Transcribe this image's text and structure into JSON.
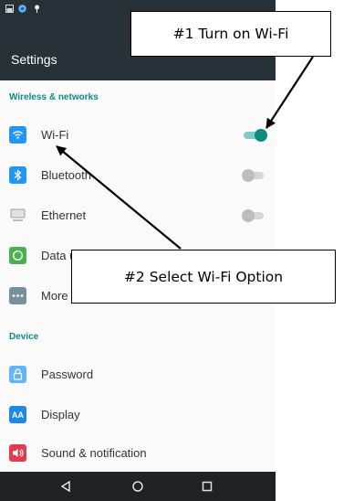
{
  "app": {
    "title": "Settings"
  },
  "sections": [
    {
      "header": "Wireless & networks",
      "rows": [
        {
          "label": "Wi-Fi",
          "icon": "wifi-icon",
          "icon_color": "#2196f3",
          "toggle": "on"
        },
        {
          "label": "Bluetooth",
          "icon": "bluetooth-icon",
          "icon_color": "#2196f3",
          "toggle": "off"
        },
        {
          "label": "Ethernet",
          "icon": "ethernet-icon",
          "icon_color": "#9e9e9e",
          "toggle": "off"
        },
        {
          "label": "Data usage",
          "icon": "data-usage-icon",
          "icon_color": "#4caf50"
        },
        {
          "label": "More",
          "icon": "more-icon",
          "icon_color": "#78909c"
        }
      ]
    },
    {
      "header": "Device",
      "rows": [
        {
          "label": "Password",
          "icon": "lock-icon",
          "icon_color": "#64b5f6"
        },
        {
          "label": "Display",
          "icon": "display-icon",
          "icon_color": "#1e88e5"
        },
        {
          "label": "Sound & notification",
          "icon": "sound-icon",
          "icon_color": "#e53950"
        }
      ]
    }
  ],
  "callouts": {
    "turn_on": "#1 Turn on Wi-Fi",
    "select": "#2 Select Wi-Fi Option"
  },
  "colors": {
    "status_bar": "#263238",
    "accent": "#0e8a83",
    "toggle_on": "#0e8a83",
    "toggle_off": "#bdbdbd",
    "nav_bar": "#1f2326"
  }
}
